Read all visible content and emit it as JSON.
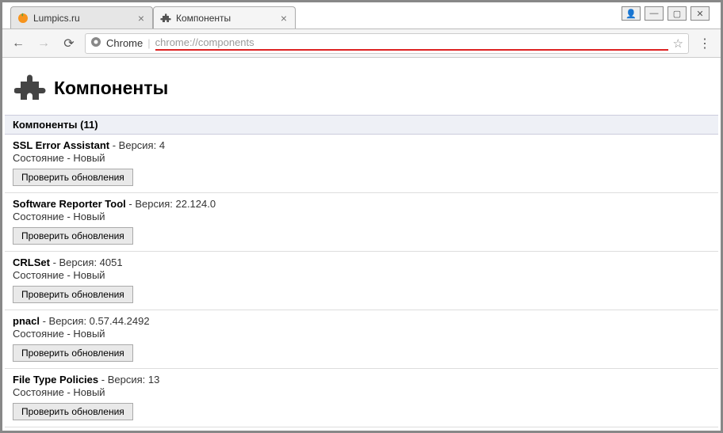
{
  "window_controls": {
    "user": "👤",
    "minimize": "—",
    "maximize": "▢",
    "close": "✕"
  },
  "tabs": [
    {
      "title": "Lumpics.ru",
      "active": false,
      "favicon": "orange"
    },
    {
      "title": "Компоненты",
      "active": true,
      "favicon": "puzzle"
    }
  ],
  "toolbar": {
    "back": "←",
    "forward": "→",
    "reload": "⟳",
    "security_label": "Chrome",
    "url": "chrome://components",
    "star": "☆",
    "menu": "⋮"
  },
  "page": {
    "title": "Компоненты",
    "section_label": "Компоненты",
    "section_count": 11,
    "version_label": "Версия",
    "status_label": "Состояние",
    "status_value": "Новый",
    "check_updates_label": "Проверить обновления",
    "components": [
      {
        "name": "SSL Error Assistant",
        "version": "4"
      },
      {
        "name": "Software Reporter Tool",
        "version": "22.124.0"
      },
      {
        "name": "CRLSet",
        "version": "4051"
      },
      {
        "name": "pnacl",
        "version": "0.57.44.2492"
      },
      {
        "name": "File Type Policies",
        "version": "13"
      }
    ]
  }
}
